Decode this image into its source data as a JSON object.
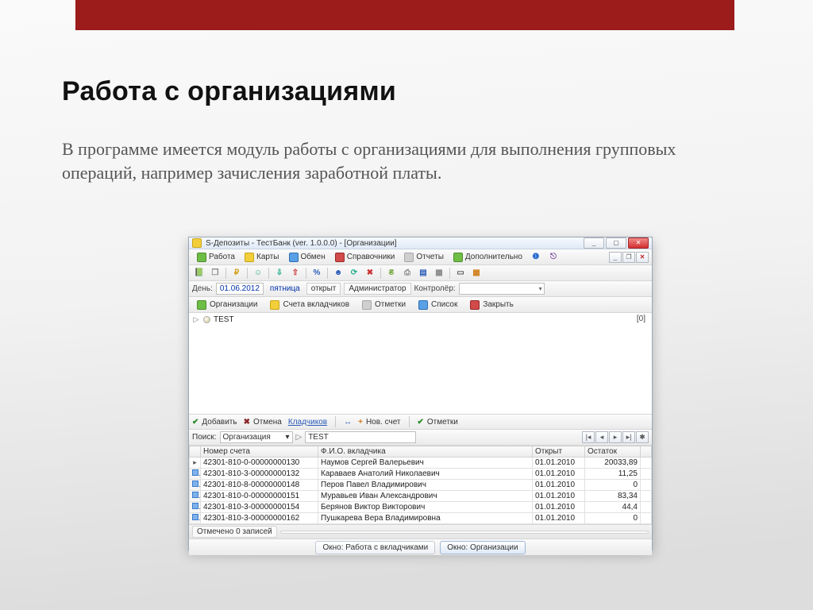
{
  "slide": {
    "title": "Работа с организациями",
    "body": "В программе имеется модуль работы с организациями для выполнения групповых операций, например зачисления заработной платы."
  },
  "window": {
    "title": "S-Депозиты - ТестБанк (ver. 1.0.0.0) - [Организации]",
    "win_controls": {
      "min": "_",
      "max": "▢",
      "close": "✕"
    },
    "mdi_controls": {
      "min": "_",
      "restore": "❐",
      "close": "✕"
    },
    "menu": [
      {
        "label": "Работа",
        "icon_class": "mi-green"
      },
      {
        "label": "Карты",
        "icon_class": "mi-yellow"
      },
      {
        "label": "Обмен",
        "icon_class": "mi-blue"
      },
      {
        "label": "Справочники",
        "icon_class": "mi-red"
      },
      {
        "label": "Отчеты",
        "icon_class": "mi-grey"
      },
      {
        "label": "Дополнительно",
        "icon_class": "mi-green"
      }
    ],
    "menu_right_icons": [
      "info-icon",
      "logout-icon"
    ],
    "toolbar_icons": [
      "book-icon",
      "doc-icon",
      "sep",
      "money-icon",
      "sep",
      "person-icon",
      "sep",
      "in-icon",
      "out-icon",
      "sep",
      "percent-icon",
      "sep",
      "user-icon",
      "refresh-icon",
      "trash-icon",
      "sep",
      "pay-icon",
      "deposit-icon",
      "card-icon",
      "grid-icon",
      "sep",
      "calc-icon",
      "calendar-icon"
    ],
    "datebar": {
      "label": "День:",
      "date": "01.06.2012",
      "weekday": "пятница",
      "status": "открыт",
      "admin": "Администратор",
      "controller_label": "Контролёр:"
    },
    "tabs": [
      {
        "label": "Организации",
        "icon_class": "mi-green"
      },
      {
        "label": "Счета вкладчиков",
        "icon_class": "mi-yellow"
      },
      {
        "label": "Отметки",
        "icon_class": "mi-grey"
      },
      {
        "label": "Список",
        "icon_class": "mi-blue"
      },
      {
        "label": "Закрыть",
        "icon_class": "mi-red"
      }
    ],
    "tree": {
      "root_label": "TEST",
      "root_count": "[0]"
    },
    "actions": {
      "add": "Добавить",
      "cancel": "Отмена",
      "depositors": "Кладчиков",
      "split_glyph": "↔",
      "newacc": "Нов. счет",
      "marks": "Отметки"
    },
    "search": {
      "label": "Поиск:",
      "mode": "Организация",
      "value": "TEST"
    },
    "grid": {
      "columns": [
        "",
        "Номер счета",
        "Ф.И.О. вкладчика",
        "Открыт",
        "Остаток"
      ],
      "rows": [
        {
          "acct": "42301-810-0-00000000130",
          "fio": "Наумов Сергей Валерьевич",
          "open": "01.01.2010",
          "bal": "20033,89",
          "current": true
        },
        {
          "acct": "42301-810-3-00000000132",
          "fio": "Караваев Анатолий Николаевич",
          "open": "01.01.2010",
          "bal": "11,25"
        },
        {
          "acct": "42301-810-8-00000000148",
          "fio": "Перов Павел Владимирович",
          "open": "01.01.2010",
          "bal": "0"
        },
        {
          "acct": "42301-810-0-00000000151",
          "fio": "Муравьев Иван Александрович",
          "open": "01.01.2010",
          "bal": "83,34"
        },
        {
          "acct": "42301-810-3-00000000154",
          "fio": "Берянов Виктор Викторович",
          "open": "01.01.2010",
          "bal": "44,4"
        },
        {
          "acct": "42301-810-3-00000000162",
          "fio": "Пушкарева Вера Владимировна",
          "open": "01.01.2010",
          "bal": "0"
        }
      ]
    },
    "status_text": "Отмечено 0 записей",
    "window_tabs": {
      "left": "Окно: Работа с вкладчиками",
      "right": "Окно: Организации"
    },
    "nav_glyphs": {
      "first": "|◂",
      "prev": "◂",
      "next": "▸",
      "last": "▸|",
      "star": "✱"
    }
  }
}
